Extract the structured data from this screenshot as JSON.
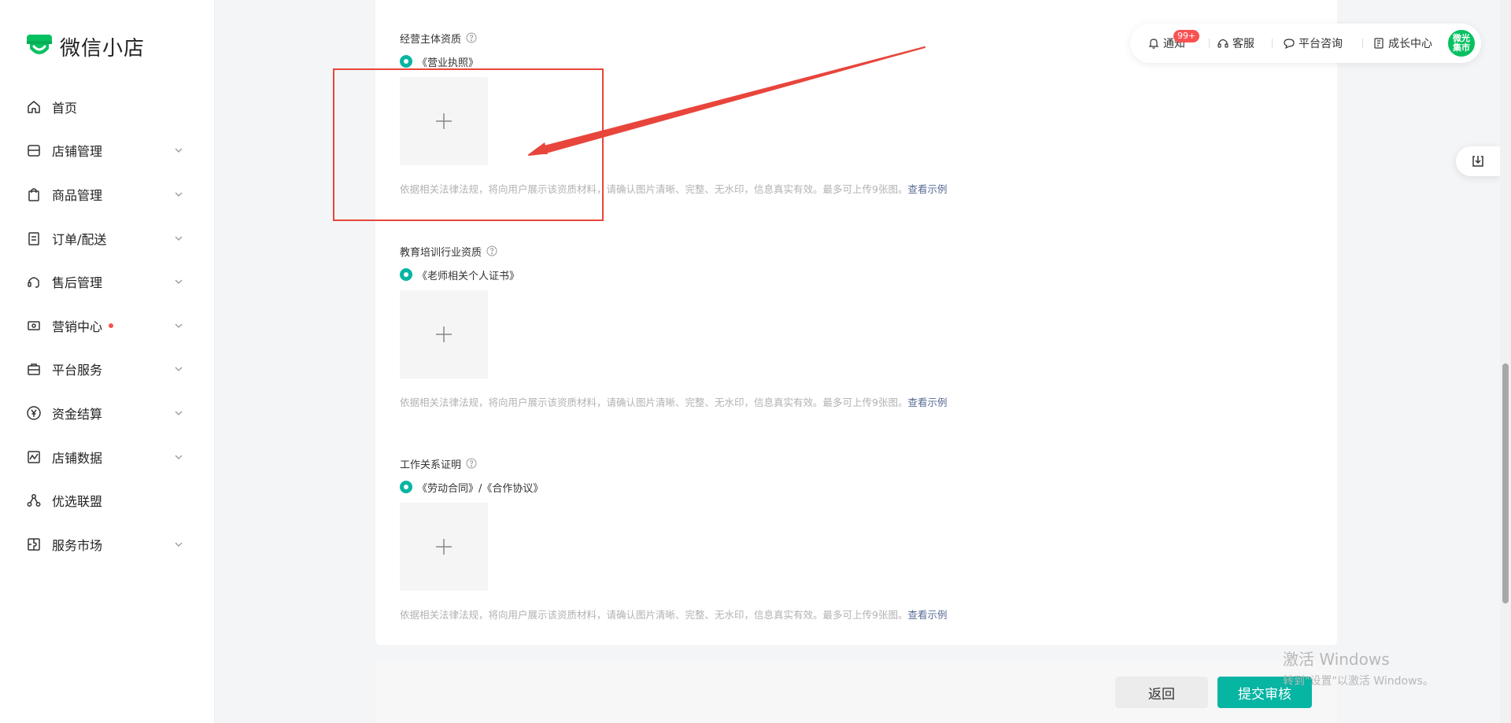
{
  "brand": {
    "title": "微信小店"
  },
  "nav": [
    {
      "label": "首页",
      "icon": "home-icon",
      "chevron": false
    },
    {
      "label": "店铺管理",
      "icon": "store-icon",
      "chevron": true
    },
    {
      "label": "商品管理",
      "icon": "shopping-bag-icon",
      "chevron": true
    },
    {
      "label": "订单/配送",
      "icon": "order-list-icon",
      "chevron": true
    },
    {
      "label": "售后管理",
      "icon": "headset-icon",
      "chevron": true
    },
    {
      "label": "营销中心",
      "icon": "ticket-icon",
      "chevron": true,
      "dot": true
    },
    {
      "label": "平台服务",
      "icon": "briefcase-icon",
      "chevron": true
    },
    {
      "label": "资金结算",
      "icon": "yuan-icon",
      "chevron": true
    },
    {
      "label": "店铺数据",
      "icon": "chart-icon",
      "chevron": true
    },
    {
      "label": "优选联盟",
      "icon": "network-icon",
      "chevron": false
    },
    {
      "label": "服务市场",
      "icon": "puzzle-icon",
      "chevron": true
    }
  ],
  "topbar": {
    "notify": "通知",
    "badge": "99+",
    "service": "客服",
    "consult": "平台咨询",
    "growth": "成长中心",
    "avatar": "微光\n集市"
  },
  "sections": [
    {
      "title": "经营主体资质",
      "option": "《营业执照》"
    },
    {
      "title": "教育培训行业资质",
      "option": "《老师相关个人证书》"
    },
    {
      "title": "工作关系证明",
      "option": "《劳动合同》/《合作协议》"
    }
  ],
  "hint": {
    "text": "依据相关法律法规，将向用户展示该资质材料，请确认图片清晰、完整、无水印，信息真实有效。最多可上传9张图。",
    "link": "查看示例"
  },
  "buttons": {
    "back": "返回",
    "submit": "提交审核"
  },
  "watermark": {
    "title": "激活 Windows",
    "subtitle": "转到\"设置\"以激活 Windows。"
  },
  "colors": {
    "accent": "#07b5a3",
    "brand_green": "#07c160",
    "link": "#576b95",
    "annotation_red": "#e8453c"
  }
}
